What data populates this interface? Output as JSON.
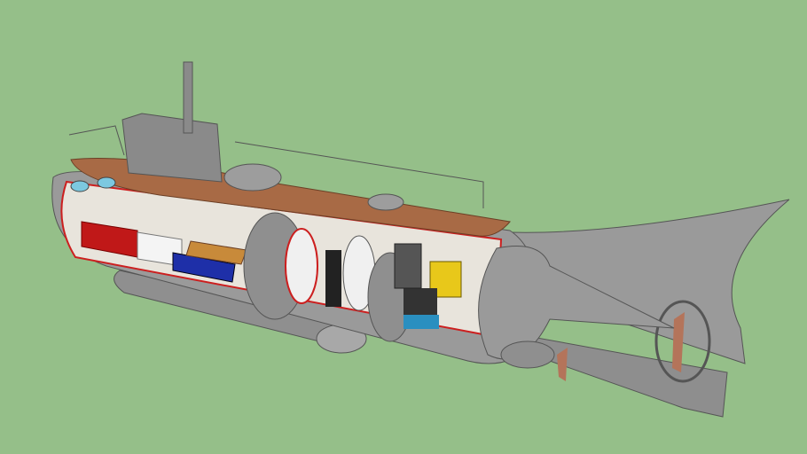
{
  "colors": {
    "background": "#95bf89",
    "hull": "#9a9a9a",
    "hull_dark": "#6f6f6f",
    "hull_light": "#b5b5b5",
    "deck": "#a86a45",
    "interior": "#e8e4dc",
    "red_trim": "#cc1f1f",
    "sofa": "#c01818",
    "bed": "#1e2fa8",
    "engine": "#e8c81a",
    "machine_blue": "#2a8fc0",
    "wood": "#c88a3a",
    "porthole": "#7cc8e0"
  }
}
